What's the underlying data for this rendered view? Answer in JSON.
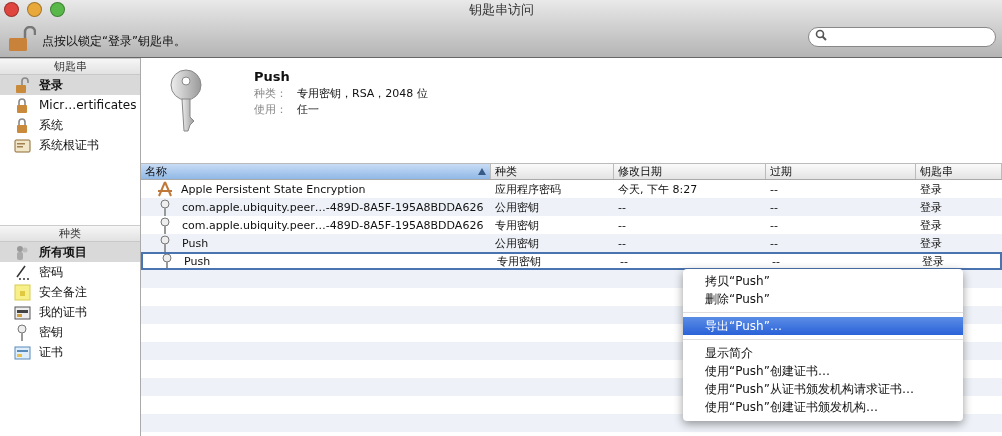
{
  "window": {
    "title": "钥匙串访问",
    "lock_prompt": "点按以锁定“登录”钥匙串。"
  },
  "sidebar": {
    "keychains": {
      "heading": "钥匙串",
      "items": [
        {
          "label": "登录",
          "kind": "lock-open",
          "selected": true
        },
        {
          "label": "Micr…ertificates",
          "kind": "lock",
          "selected": false
        },
        {
          "label": "系统",
          "kind": "lock",
          "selected": false
        },
        {
          "label": "系统根证书",
          "kind": "cert-folder",
          "selected": false
        }
      ]
    },
    "categories": {
      "heading": "种类",
      "items": [
        {
          "label": "所有项目",
          "kind": "all",
          "selected": true
        },
        {
          "label": "密码",
          "kind": "password",
          "selected": false
        },
        {
          "label": "安全备注",
          "kind": "note",
          "selected": false
        },
        {
          "label": "我的证书",
          "kind": "my-cert",
          "selected": false
        },
        {
          "label": "密钥",
          "kind": "key",
          "selected": false
        },
        {
          "label": "证书",
          "kind": "cert",
          "selected": false
        }
      ]
    }
  },
  "detail": {
    "title": "Push",
    "fields": [
      {
        "label": "种类：",
        "value": "专用密钥，RSA，2048 位"
      },
      {
        "label": "使用：",
        "value": "任一"
      }
    ]
  },
  "table": {
    "columns": [
      {
        "label": "名称",
        "sorted": true
      },
      {
        "label": "种类",
        "sorted": false
      },
      {
        "label": "修改日期",
        "sorted": false
      },
      {
        "label": "过期",
        "sorted": false
      },
      {
        "label": "钥匙串",
        "sorted": false
      }
    ],
    "rows": [
      {
        "kind": "password",
        "cells": [
          "Apple Persistent State Encryption",
          "应用程序密码",
          "今天, 下午 8:27",
          "--",
          "登录"
        ],
        "selected": false
      },
      {
        "kind": "key",
        "cells": [
          "com.apple.ubiquity.peer…-489D-8A5F-195A8BDDA626",
          "公用密钥",
          "--",
          "--",
          "登录"
        ],
        "selected": false
      },
      {
        "kind": "key",
        "cells": [
          "com.apple.ubiquity.peer…-489D-8A5F-195A8BDDA626",
          "专用密钥",
          "--",
          "--",
          "登录"
        ],
        "selected": false
      },
      {
        "kind": "key",
        "cells": [
          "Push",
          "公用密钥",
          "--",
          "--",
          "登录"
        ],
        "selected": false
      },
      {
        "kind": "key",
        "cells": [
          "Push",
          "专用密钥",
          "--",
          "--",
          "登录"
        ],
        "selected": true
      }
    ]
  },
  "context_menu": {
    "groups": [
      [
        {
          "label": "拷贝“Push”",
          "selected": false
        },
        {
          "label": "删除“Push”",
          "selected": false
        }
      ],
      [
        {
          "label": "导出“Push”…",
          "selected": true
        }
      ],
      [
        {
          "label": "显示简介",
          "selected": false
        },
        {
          "label": "使用“Push”创建证书…",
          "selected": false
        },
        {
          "label": "使用“Push”从证书颁发机构请求证书…",
          "selected": false
        },
        {
          "label": "使用“Push”创建证书颁发机构…",
          "selected": false
        }
      ]
    ]
  }
}
